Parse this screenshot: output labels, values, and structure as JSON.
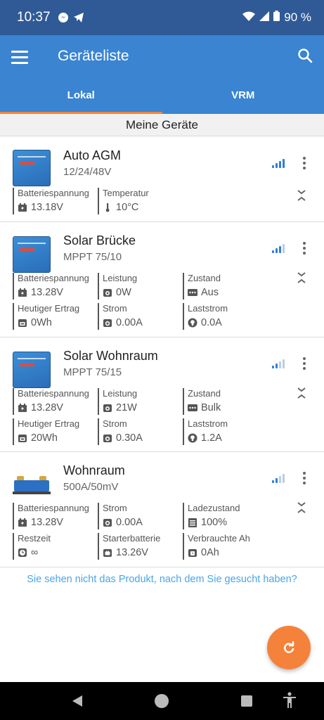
{
  "status_bar": {
    "time": "10:37",
    "battery": "90 %"
  },
  "app_bar": {
    "title": "Geräteliste"
  },
  "tabs": [
    {
      "label": "Lokal",
      "active": true
    },
    {
      "label": "VRM",
      "active": false
    }
  ],
  "section": {
    "title": "Meine Geräte"
  },
  "devices": [
    {
      "name": "Auto AGM",
      "model": "12/24/48V",
      "signal_bars": 4,
      "metrics": [
        {
          "label": "Batteriespannung",
          "value": "13.18V",
          "icon": "battery-icon"
        },
        {
          "label": "Temperatur",
          "value": "10°C",
          "icon": "thermometer-icon"
        }
      ]
    },
    {
      "name": "Solar Brücke",
      "model": "MPPT 75/10",
      "signal_bars": 3,
      "metrics": [
        {
          "label": "Batteriespannung",
          "value": "13.28V",
          "icon": "battery-icon"
        },
        {
          "label": "Leistung",
          "value": "0W",
          "icon": "power-icon"
        },
        {
          "label": "Zustand",
          "value": "Aus",
          "icon": "state-icon"
        },
        {
          "label": "Heutiger Ertrag",
          "value": "0Wh",
          "icon": "yield-icon"
        },
        {
          "label": "Strom",
          "value": "0.00A",
          "icon": "current-icon"
        },
        {
          "label": "Laststrom",
          "value": "0.0A",
          "icon": "bulb-icon"
        }
      ]
    },
    {
      "name": "Solar Wohnraum",
      "model": "MPPT 75/15",
      "signal_bars": 2,
      "metrics": [
        {
          "label": "Batteriespannung",
          "value": "13.28V",
          "icon": "battery-icon"
        },
        {
          "label": "Leistung",
          "value": "21W",
          "icon": "power-icon"
        },
        {
          "label": "Zustand",
          "value": "Bulk",
          "icon": "state-icon"
        },
        {
          "label": "Heutiger Ertrag",
          "value": "20Wh",
          "icon": "yield-icon"
        },
        {
          "label": "Strom",
          "value": "0.30A",
          "icon": "current-icon"
        },
        {
          "label": "Laststrom",
          "value": "1.2A",
          "icon": "bulb-icon"
        }
      ]
    },
    {
      "name": "Wohnraum",
      "model": "500A/50mV",
      "signal_bars": 2,
      "metrics": [
        {
          "label": "Batteriespannung",
          "value": "13.28V",
          "icon": "battery-icon"
        },
        {
          "label": "Strom",
          "value": "0.00A",
          "icon": "current-icon"
        },
        {
          "label": "Ladezustand",
          "value": "100%",
          "icon": "soc-icon"
        },
        {
          "label": "Restzeit",
          "value": "∞",
          "icon": "clock-icon"
        },
        {
          "label": "Starterbatterie",
          "value": "13.26V",
          "icon": "starter-battery-icon"
        },
        {
          "label": "Verbrauchte Ah",
          "value": "0Ah",
          "icon": "consumed-icon"
        }
      ]
    }
  ],
  "not_found_link": "Sie sehen nicht das Produkt, nach dem Sie gesucht haben?",
  "colors": {
    "primary": "#3a84d1",
    "status_bar": "#2f5a96",
    "accent": "#f5823a",
    "link": "#4aa5e6"
  }
}
